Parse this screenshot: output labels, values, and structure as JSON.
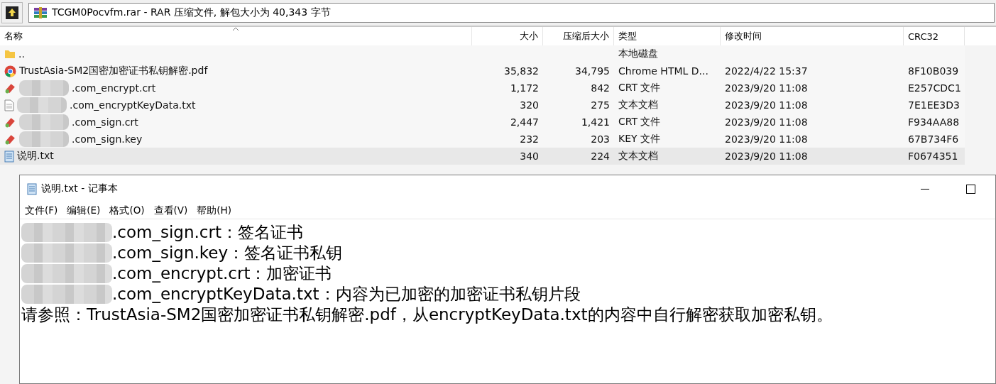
{
  "archive": {
    "address": "TCGM0Pocvfm.rar - RAR 压缩文件, 解包大小为 40,343 字节"
  },
  "table": {
    "columns": [
      "名称",
      "大小",
      "压缩后大小",
      "类型",
      "修改时间",
      "CRC32"
    ],
    "rows": [
      {
        "kind": "folder",
        "name": "..",
        "size": "",
        "packed": "",
        "type": "本地磁盘",
        "modified": "",
        "crc": "",
        "selected": false,
        "redacted": false
      },
      {
        "kind": "browser",
        "name": "TrustAsia-SM2国密加密证书私钥解密.pdf",
        "size": "35,832",
        "packed": "34,795",
        "type": "Chrome HTML D...",
        "modified": "2022/4/22 15:37",
        "crc": "8F10B039",
        "selected": false,
        "redacted": false
      },
      {
        "kind": "certificate",
        "name": ".com_encrypt.crt",
        "size": "1,172",
        "packed": "842",
        "type": "CRT 文件",
        "modified": "2023/9/20 11:08",
        "crc": "E257CDC1",
        "selected": false,
        "redacted": true
      },
      {
        "kind": "text",
        "name": ".com_encryptKeyData.txt",
        "size": "320",
        "packed": "275",
        "type": "文本文档",
        "modified": "2023/9/20 11:08",
        "crc": "7E1EE3D3",
        "selected": false,
        "redacted": true
      },
      {
        "kind": "certificate",
        "name": ".com_sign.crt",
        "size": "2,447",
        "packed": "1,421",
        "type": "CRT 文件",
        "modified": "2023/9/20 11:08",
        "crc": "F934AA88",
        "selected": false,
        "redacted": true
      },
      {
        "kind": "certificate",
        "name": ".com_sign.key",
        "size": "232",
        "packed": "203",
        "type": "KEY 文件",
        "modified": "2023/9/20 11:08",
        "crc": "67B734F6",
        "selected": false,
        "redacted": true
      },
      {
        "kind": "notepad",
        "name": "说明.txt",
        "size": "340",
        "packed": "224",
        "type": "文本文档",
        "modified": "2023/9/20 11:08",
        "crc": "F0674351",
        "selected": true,
        "redacted": false
      }
    ]
  },
  "notepad": {
    "title": "说明.txt - 记事本",
    "menu": [
      "文件(F)",
      "编辑(E)",
      "格式(O)",
      "查看(V)",
      "帮助(H)"
    ],
    "lines": [
      {
        "text": ".com_sign.crt：签名证书",
        "redacted": true
      },
      {
        "text": ".com_sign.key：签名证书私钥",
        "redacted": true
      },
      {
        "text": ".com_encrypt.crt：加密证书",
        "redacted": true
      },
      {
        "text": ".com_encryptKeyData.txt：内容为已加密的加密证书私钥片段",
        "redacted": true
      },
      {
        "text": "请参照：TrustAsia-SM2国密加密证书私钥解密.pdf，从encryptKeyData.txt的内容中自行解密获取加密私钥。",
        "redacted": false
      }
    ]
  }
}
